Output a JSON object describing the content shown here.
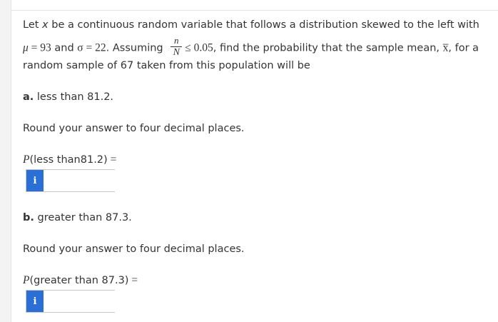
{
  "cutoff_text": "...",
  "problem": {
    "line1_prefix": "Let ",
    "line1_var": "x",
    "line1_suffix": " be a continuous random variable that follows a distribution skewed to the left with",
    "mu_symbol": "μ",
    "mu_eq": " = 93",
    "and_text": " and ",
    "sigma_eq": "σ = 22",
    "assuming_text": ". Assuming ",
    "frac_num": "n",
    "frac_den": "N",
    "le_value": "≤ 0.05",
    "line2_suffix_a": ", find the probability that the sample mean, ",
    "xbar": "x̅",
    "line2_suffix_b": ", for a",
    "line3": "random sample of 67 taken from this population will be"
  },
  "part_a": {
    "label": "a.",
    "text": " less than 81.2.",
    "round_text": "Round your answer to four decimal places.",
    "p_prefix": "P",
    "p_inner": "(less than81.2)",
    "p_eq": " =",
    "input_value": "",
    "info_icon": "i"
  },
  "part_b": {
    "label": "b.",
    "text": " greater than 87.3.",
    "round_text": "Round your answer to four decimal places.",
    "p_prefix": "P",
    "p_inner": "(greater than 87.3)",
    "p_eq": " =",
    "input_value": "",
    "info_icon": "i"
  },
  "colors": {
    "info_button": "#2a6fd6",
    "text": "#343434"
  }
}
